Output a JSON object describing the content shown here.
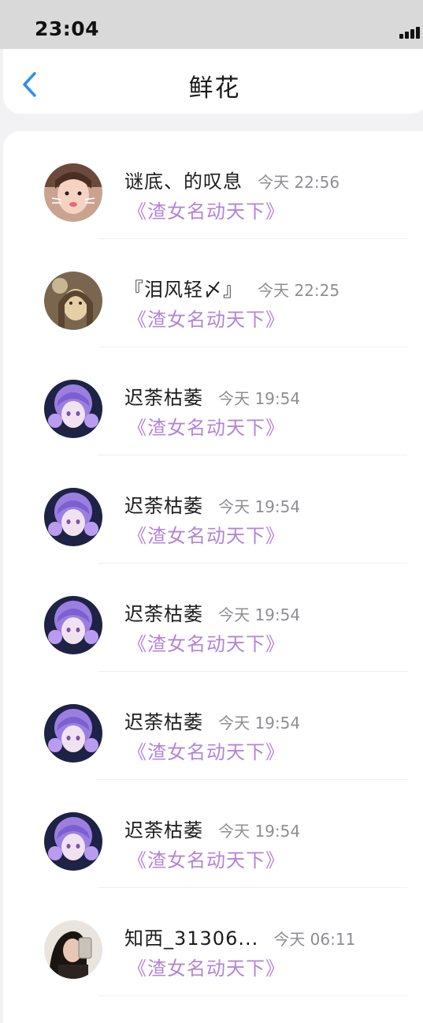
{
  "status_bar": {
    "time": "23:04"
  },
  "header": {
    "title": "鲜花"
  },
  "list": [
    {
      "name": "谜底、的叹息",
      "time": "今天 22:56",
      "gift": "《渣女名动天下》",
      "avatar": "girl-cat-filter"
    },
    {
      "name": "『泪风轻〆』",
      "time": "今天 22:25",
      "gift": "《渣女名动天下》",
      "avatar": "sepia-anime-girl"
    },
    {
      "name": "迟荼枯萎",
      "time": "今天 19:54",
      "gift": "《渣女名动天下》",
      "avatar": "purple-anime-girl"
    },
    {
      "name": "迟荼枯萎",
      "time": "今天 19:54",
      "gift": "《渣女名动天下》",
      "avatar": "purple-anime-girl"
    },
    {
      "name": "迟荼枯萎",
      "time": "今天 19:54",
      "gift": "《渣女名动天下》",
      "avatar": "purple-anime-girl"
    },
    {
      "name": "迟荼枯萎",
      "time": "今天 19:54",
      "gift": "《渣女名动天下》",
      "avatar": "purple-anime-girl"
    },
    {
      "name": "迟荼枯萎",
      "time": "今天 19:54",
      "gift": "《渣女名动天下》",
      "avatar": "purple-anime-girl"
    },
    {
      "name": "知西_31306...",
      "time": "今天 06:11",
      "gift": "《渣女名动天下》",
      "avatar": "mirror-selfie-girl"
    }
  ],
  "colors": {
    "accent": "#2f8fe6",
    "gift_text": "#b384d8",
    "time_text": "#8e8e93",
    "page_bg": "#f2f2f5",
    "status_bar_bg": "#d9d9d9"
  }
}
